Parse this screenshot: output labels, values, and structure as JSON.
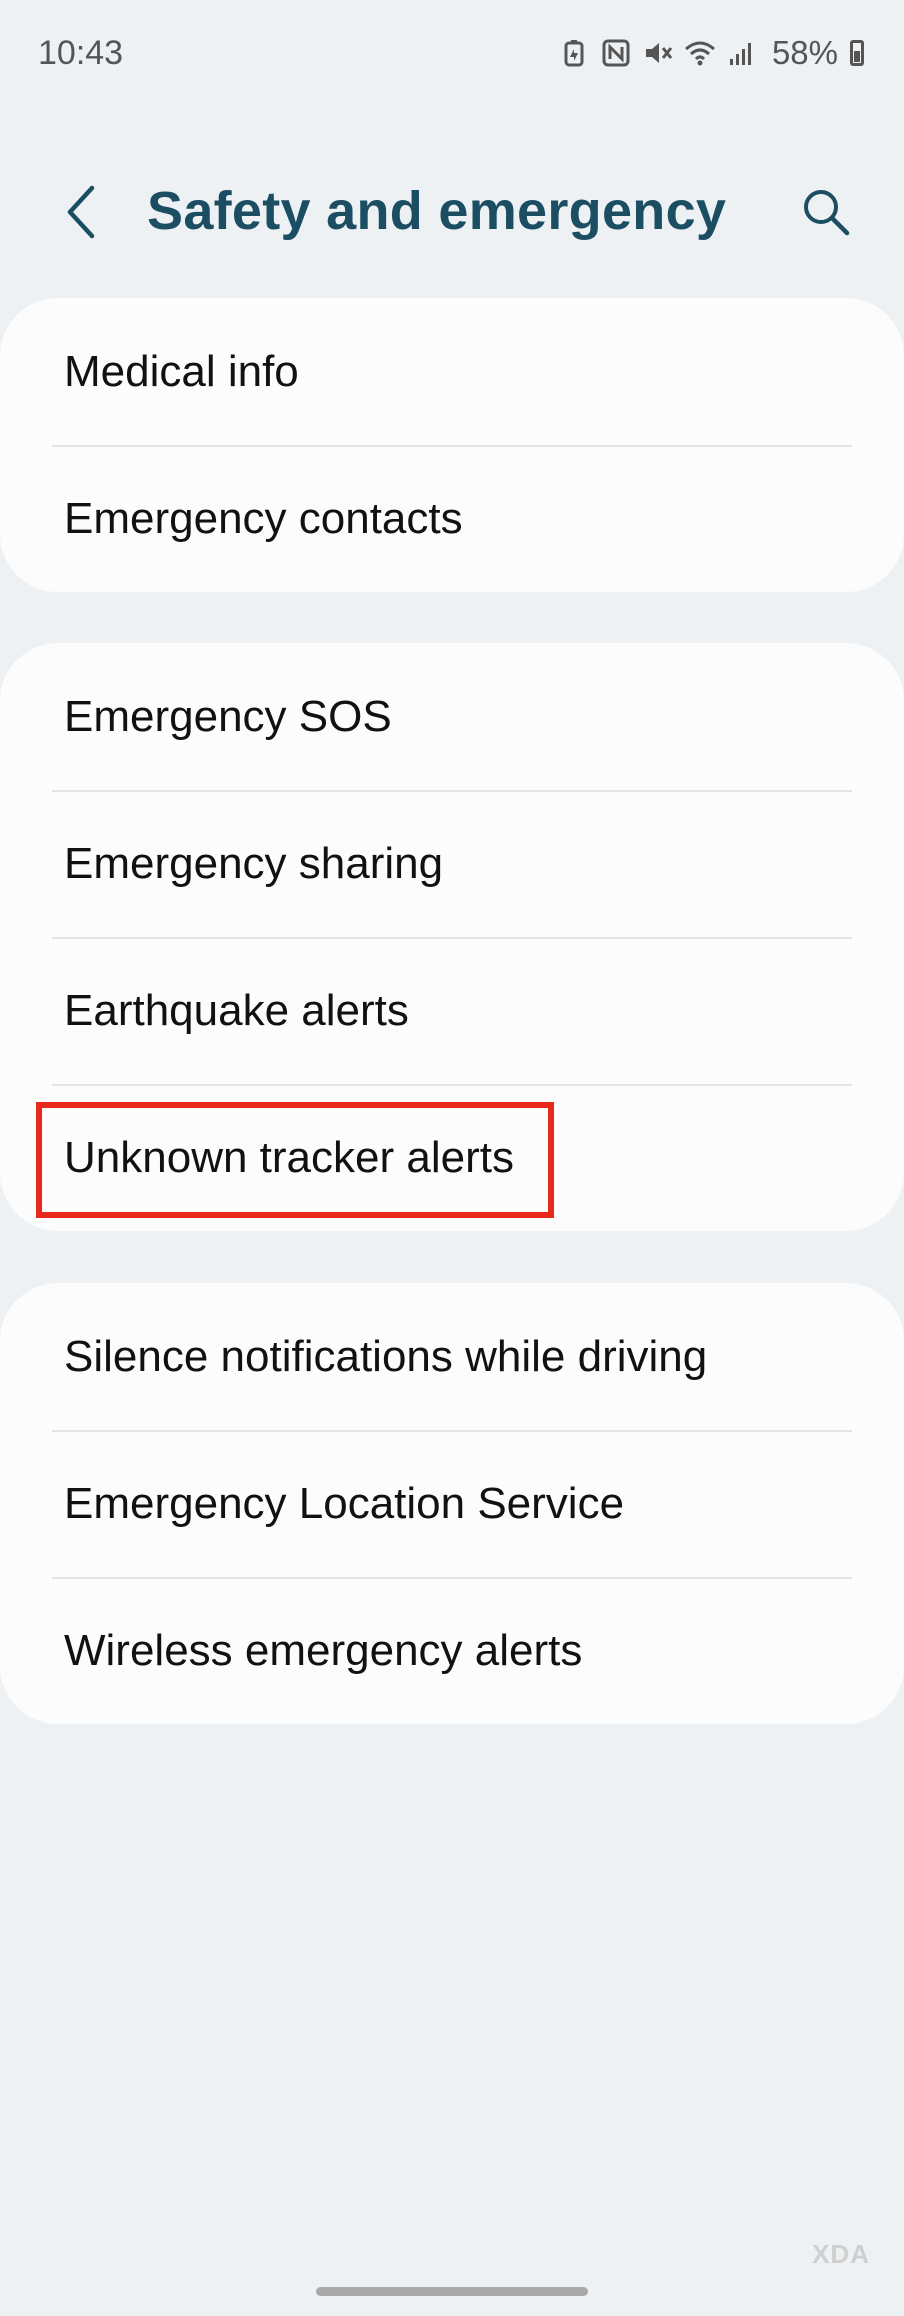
{
  "status_bar": {
    "time": "10:43",
    "battery_percent": "58%",
    "icons": [
      "battery-saver-icon",
      "nfc-icon",
      "mute-icon",
      "wifi-icon",
      "signal-icon",
      "battery-icon"
    ]
  },
  "header": {
    "title": "Safety and emergency",
    "back_icon": "back-arrow-icon",
    "search_icon": "search-icon"
  },
  "groups": [
    {
      "items": [
        {
          "label": "Medical info"
        },
        {
          "label": "Emergency contacts"
        }
      ]
    },
    {
      "items": [
        {
          "label": "Emergency SOS"
        },
        {
          "label": "Emergency sharing"
        },
        {
          "label": "Earthquake alerts"
        },
        {
          "label": "Unknown tracker alerts",
          "highlighted": true
        }
      ]
    },
    {
      "items": [
        {
          "label": "Silence notifications while driving"
        },
        {
          "label": "Emergency Location Service"
        },
        {
          "label": "Wireless emergency alerts"
        }
      ]
    }
  ],
  "colors": {
    "background": "#edf1f4",
    "card": "#fcfcfc",
    "title": "#1b4d63",
    "highlight_border": "#e8281c"
  },
  "watermark": "XDA"
}
